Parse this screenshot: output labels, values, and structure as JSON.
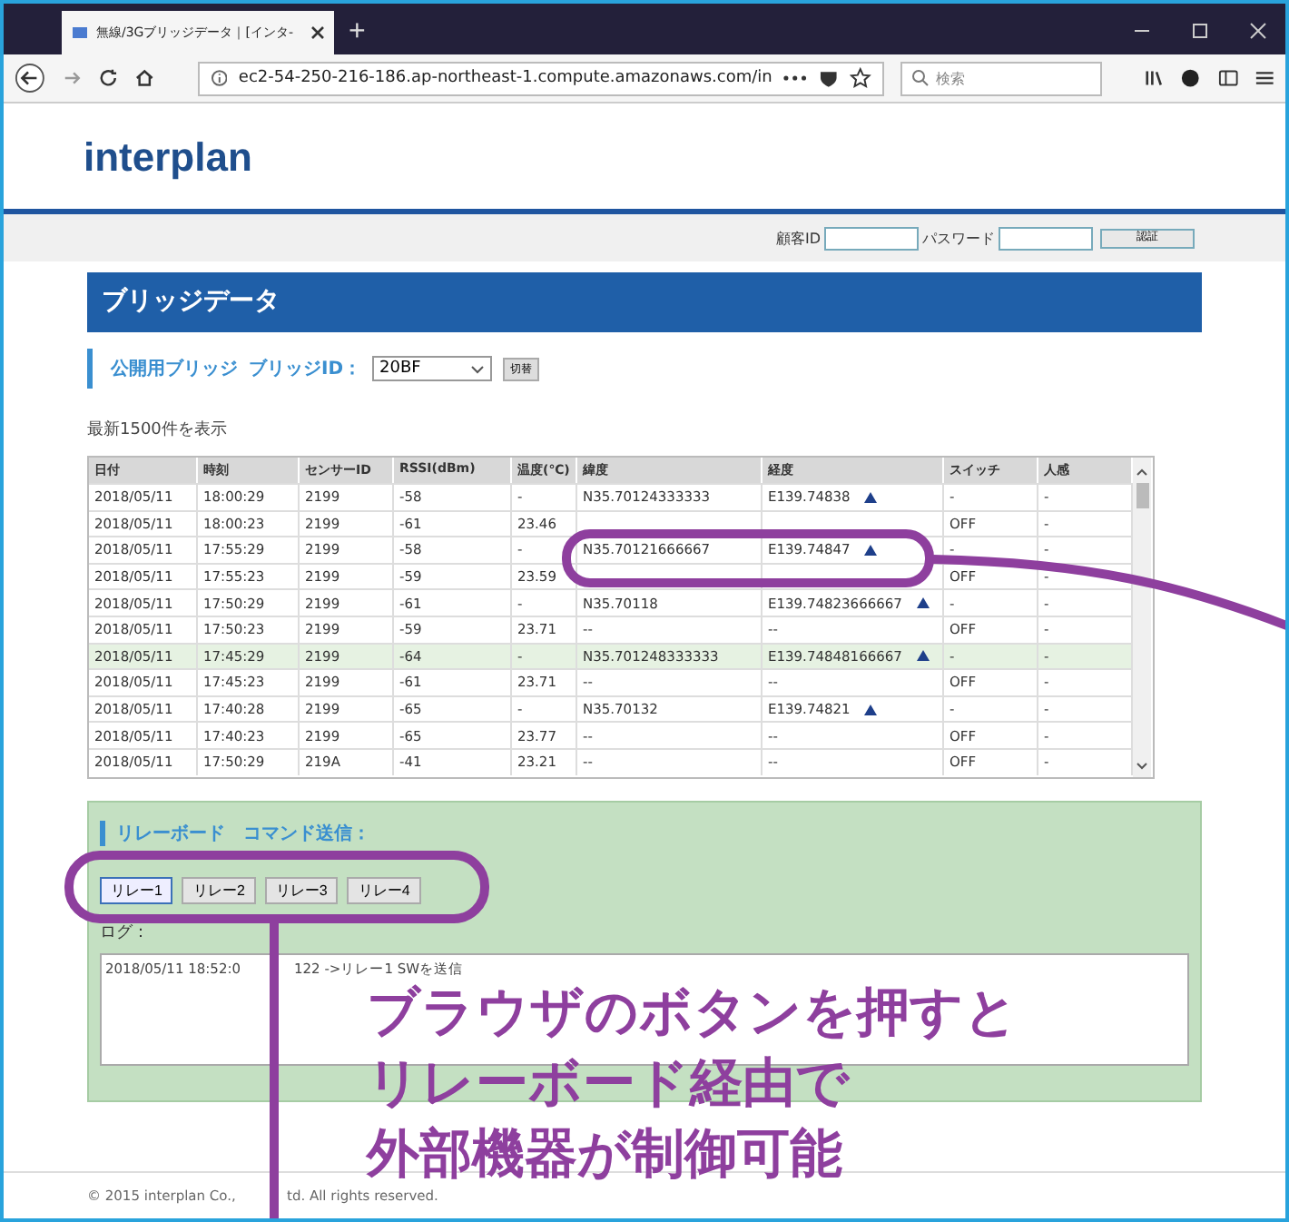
{
  "browser": {
    "tab_title": "無線/3Gブリッジデータ｜[インタ-",
    "new_tab": "+",
    "url": "ec2-54-250-216-186.ap-northeast-1.compute.amazonaws.com/in",
    "search_placeholder": "検索"
  },
  "site": {
    "logo": "interplan",
    "login": {
      "id_label": "顧客ID",
      "password_label": "パスワード",
      "button": "認証"
    }
  },
  "panel": {
    "title": "ブリッジデータ",
    "bridge_label": "公開用ブリッジ",
    "id_label": "ブリッジID：",
    "bridge_id": "20BF",
    "switch_button": "切替",
    "count_text": "最新1500件を表示"
  },
  "table": {
    "columns": [
      "日付",
      "時刻",
      "センサーID",
      "RSSI(dBm)",
      "温度(℃)",
      "緯度",
      "経度",
      "スイッチ",
      "人感"
    ],
    "rows": [
      {
        "selected": false,
        "marker": true,
        "cells": [
          "2018/05/11",
          "18:00:29",
          "2199",
          "-58",
          "-",
          "N35.70124333333",
          "E139.74838",
          "-",
          "-"
        ]
      },
      {
        "selected": false,
        "marker": false,
        "cells": [
          "2018/05/11",
          "18:00:23",
          "2199",
          "-61",
          "23.46",
          null,
          null,
          "OFF",
          "-"
        ]
      },
      {
        "selected": false,
        "marker": true,
        "cells": [
          "2018/05/11",
          "17:55:29",
          "2199",
          "-58",
          "-",
          "N35.70121666667",
          "E139.74847",
          "-",
          "-"
        ]
      },
      {
        "selected": false,
        "marker": false,
        "cells": [
          "2018/05/11",
          "17:55:23",
          "2199",
          "-59",
          "23.59",
          null,
          null,
          "OFF",
          "-"
        ]
      },
      {
        "selected": false,
        "marker": true,
        "cells": [
          "2018/05/11",
          "17:50:29",
          "2199",
          "-61",
          "-",
          "N35.70118",
          "E139.74823666667",
          "-",
          "-"
        ]
      },
      {
        "selected": false,
        "marker": false,
        "cells": [
          "2018/05/11",
          "17:50:23",
          "2199",
          "-59",
          "23.71",
          "--",
          "--",
          "OFF",
          "-"
        ]
      },
      {
        "selected": true,
        "marker": true,
        "cells": [
          "2018/05/11",
          "17:45:29",
          "2199",
          "-64",
          "-",
          "N35.701248333333",
          "E139.74848166667",
          "-",
          "-"
        ]
      },
      {
        "selected": false,
        "marker": false,
        "cells": [
          "2018/05/11",
          "17:45:23",
          "2199",
          "-61",
          "23.71",
          "--",
          "--",
          "OFF",
          "-"
        ]
      },
      {
        "selected": false,
        "marker": true,
        "cells": [
          "2018/05/11",
          "17:40:28",
          "2199",
          "-65",
          "-",
          "N35.70132",
          "E139.74821",
          "-",
          "-"
        ]
      },
      {
        "selected": false,
        "marker": false,
        "cells": [
          "2018/05/11",
          "17:40:23",
          "2199",
          "-65",
          "23.77",
          "--",
          "--",
          "OFF",
          "-"
        ]
      },
      {
        "selected": false,
        "marker": false,
        "cells": [
          "2018/05/11",
          "17:50:29",
          "219A",
          "-41",
          "23.21",
          "--",
          "--",
          "OFF",
          "-"
        ]
      }
    ]
  },
  "relay": {
    "title": "リレーボード　コマンド送信：",
    "buttons": [
      {
        "label": "リレー1",
        "selected": true
      },
      {
        "label": "リレー2",
        "selected": false
      },
      {
        "label": "リレー3",
        "selected": false
      },
      {
        "label": "リレー4",
        "selected": false
      }
    ],
    "log_label": "ログ：",
    "log_parts": [
      "2018/05/11 18:52:0",
      "122 ->リレー1 SWを送信"
    ]
  },
  "footer": [
    "© 2015 interplan Co.,",
    "td. All rights reserved."
  ],
  "annotation": {
    "lines": [
      "ブラウザのボタンを押すと",
      "リレーボード経由で",
      "外部機器が制御可能"
    ]
  }
}
